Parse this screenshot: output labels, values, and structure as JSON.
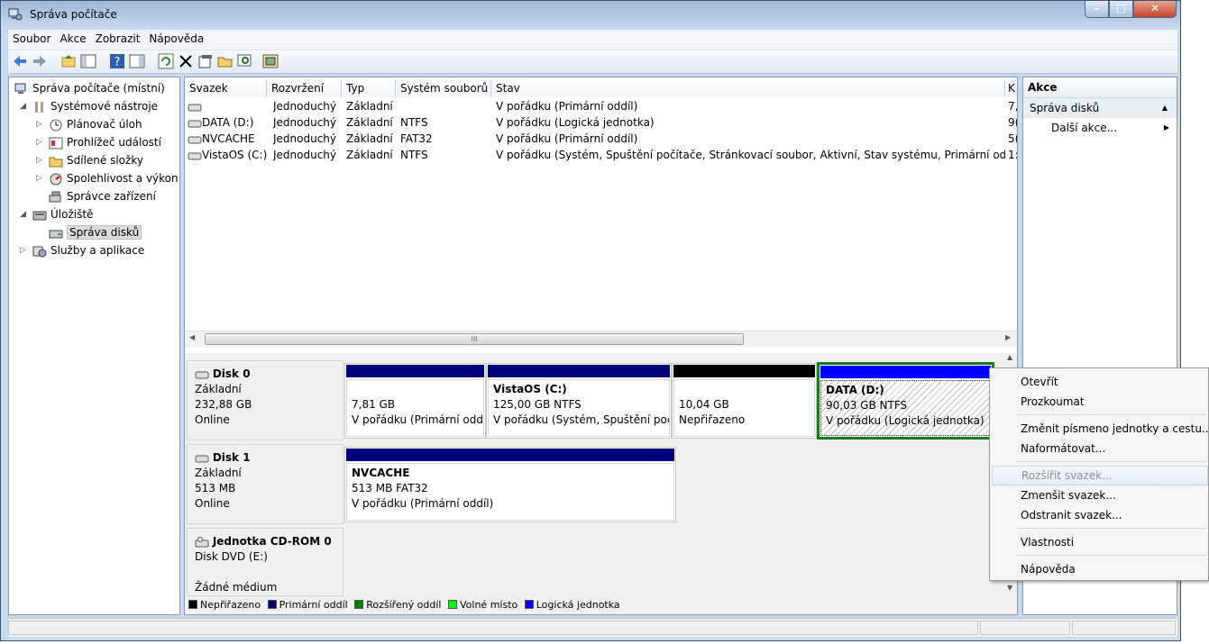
{
  "window": {
    "title": "Správa počítače"
  },
  "menu": [
    "Soubor",
    "Akce",
    "Zobrazit",
    "Nápověda"
  ],
  "tree": {
    "root": "Správa počítače (místní)",
    "system_tools": "Systémové nástroje",
    "task_scheduler": "Plánovač úloh",
    "event_viewer": "Prohlížeč událostí",
    "shared_folders": "Sdílené složky",
    "reliability": "Spolehlivost a výkon",
    "device_manager": "Správce zařízení",
    "storage": "Úložiště",
    "disk_management": "Správa disků",
    "services": "Služby a aplikace"
  },
  "volumes": {
    "columns": [
      "Svazek",
      "Rozvržení",
      "Typ",
      "Systém souborů",
      "Stav",
      "K"
    ],
    "rows": [
      {
        "name": "",
        "layout": "Jednoduchý",
        "type": "Základní",
        "fs": "",
        "status": "V pořádku (Primární oddíl)",
        "cap": "7,"
      },
      {
        "name": "DATA (D:)",
        "layout": "Jednoduchý",
        "type": "Základní",
        "fs": "NTFS",
        "status": "V pořádku (Logická jednotka)",
        "cap": "9("
      },
      {
        "name": "NVCACHE",
        "layout": "Jednoduchý",
        "type": "Základní",
        "fs": "FAT32",
        "status": "V pořádku (Primární oddíl)",
        "cap": "5("
      },
      {
        "name": "VistaOS (C:)",
        "layout": "Jednoduchý",
        "type": "Základní",
        "fs": "NTFS",
        "status": "V pořádku (Systém, Spuštění počítače, Stránkovací soubor, Aktivní, Stav systému, Primární oddíl)",
        "cap": "1:"
      }
    ],
    "scroll_grip": "III"
  },
  "disks": {
    "disk0": {
      "name": "Disk 0",
      "type": "Základní",
      "size": "232,88 GB",
      "state": "Online",
      "p1": {
        "size": "7,81 GB",
        "status": "V pořádku (Primární odd"
      },
      "p2": {
        "name": "VistaOS  (C:)",
        "size": "125,00 GB NTFS",
        "status": "V pořádku (Systém, Spuštění poč"
      },
      "p3": {
        "size": "10,04 GB",
        "status": "Nepřiřazeno"
      },
      "p4": {
        "name": "DATA  (D:)",
        "size": "90,03 GB NTFS",
        "status": "V pořádku (Logická jednotka)"
      }
    },
    "disk1": {
      "name": "Disk 1",
      "type": "Základní",
      "size": "513 MB",
      "state": "Online",
      "p1": {
        "name": "NVCACHE",
        "size": "513 MB FAT32",
        "status": "V pořádku (Primární oddíl)"
      }
    },
    "cdrom": {
      "name": "Jednotka CD-ROM 0",
      "type": "Disk DVD (E:)",
      "state": "Žádné médium"
    }
  },
  "legend": [
    "Nepřiřazeno",
    "Primární oddíl",
    "Rozšířený oddíl",
    "Volné místo",
    "Logická jednotka"
  ],
  "colors": {
    "unallocated": "#000000",
    "primary": "#00007b",
    "extended": "#008000",
    "free": "#00ff00",
    "logical": "#0000ff"
  },
  "actions": {
    "header": "Akce",
    "section": "Správa disků",
    "more": "Další akce..."
  },
  "context_menu": {
    "open": "Otevřít",
    "explore": "Prozkoumat",
    "change_letter": "Změnit písmeno jednotky a cestu...",
    "format": "Naformátovat...",
    "extend": "Rozšířit svazek...",
    "shrink": "Zmenšit svazek...",
    "delete": "Odstranit svazek...",
    "properties": "Vlastnosti",
    "help": "Nápověda"
  }
}
